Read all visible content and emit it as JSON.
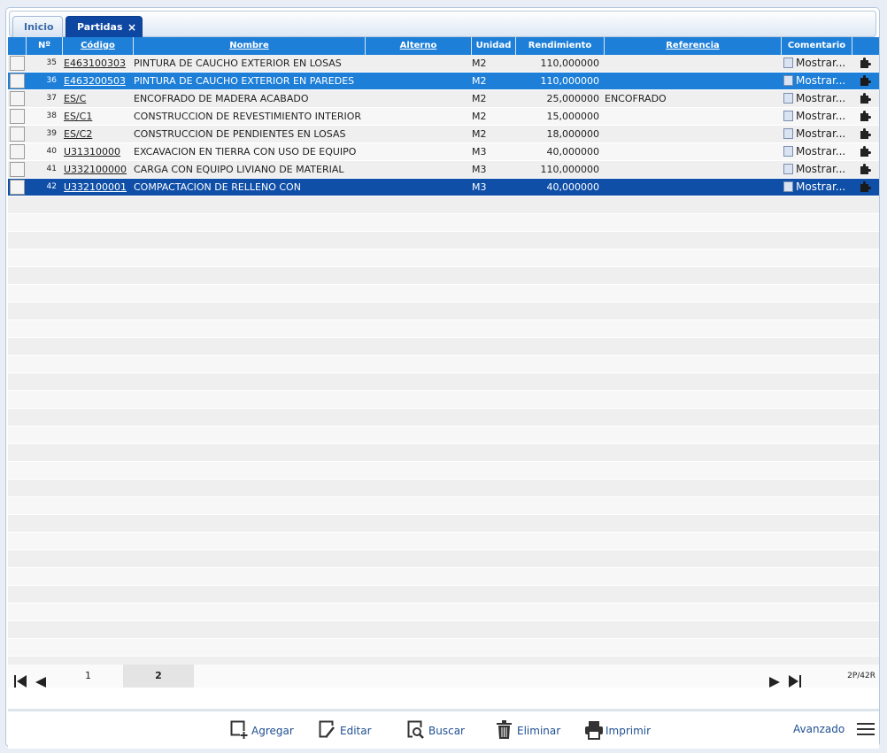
{
  "tabs": [
    {
      "label": "Inicio"
    },
    {
      "label": "Partidas",
      "close": "×"
    }
  ],
  "grid": {
    "columns": {
      "num": "Nº",
      "code": "Código",
      "name": "Nombre",
      "alt": "Alterno",
      "unit": "Unidad",
      "rend": "Rendimiento",
      "ref": "Referencia",
      "com": "Comentario"
    },
    "rows": [
      {
        "num": "35",
        "code": "E463100303",
        "name": "PINTURA DE CAUCHO EXTERIOR EN LOSAS",
        "unit": "M2",
        "rend": "110,000000",
        "ref": "",
        "com": "Mostrar..."
      },
      {
        "num": "36",
        "code": "E463200503",
        "name": "PINTURA DE CAUCHO EXTERIOR EN PAREDES",
        "unit": "M2",
        "rend": "110,000000",
        "ref": "",
        "com": "Mostrar..."
      },
      {
        "num": "37",
        "code": "ES/C",
        "name": "ENCOFRADO DE MADERA ACABADO",
        "unit": "M2",
        "rend": "25,000000",
        "ref": "ENCOFRADO",
        "com": "Mostrar..."
      },
      {
        "num": "38",
        "code": "ES/C1",
        "name": "CONSTRUCCION DE REVESTIMIENTO INTERIOR",
        "unit": "M2",
        "rend": "15,000000",
        "ref": "",
        "com": "Mostrar..."
      },
      {
        "num": "39",
        "code": "ES/C2",
        "name": "CONSTRUCCION DE PENDIENTES EN LOSAS",
        "unit": "M2",
        "rend": "18,000000",
        "ref": "",
        "com": "Mostrar..."
      },
      {
        "num": "40",
        "code": "U31310000",
        "name": "EXCAVACION EN TIERRA CON USO DE EQUIPO",
        "unit": "M3",
        "rend": "40,000000",
        "ref": "",
        "com": "Mostrar..."
      },
      {
        "num": "41",
        "code": "U332100000",
        "name": "CARGA CON EQUIPO LIVIANO DE MATERIAL",
        "unit": "M3",
        "rend": "110,000000",
        "ref": "",
        "com": "Mostrar..."
      },
      {
        "num": "42",
        "code": "U332100001",
        "name": "COMPACTACION DE RELLENO CON",
        "unit": "M3",
        "rend": "40,000000",
        "ref": "",
        "com": "Mostrar..."
      }
    ]
  },
  "pager": {
    "pages": [
      "1",
      "2"
    ],
    "current_page": "2",
    "count": "2P/42R"
  },
  "footer": {
    "add": "Agregar",
    "edit": "Editar",
    "search": "Buscar",
    "delete": "Eliminar",
    "print": "Imprimir",
    "advanced": "Avanzado"
  },
  "colors": {
    "header": "#1e7fd8",
    "tab_active": "#0d47a1",
    "row_selected": "#1e7fd8",
    "row_selected_dark": "#0f4fa8"
  }
}
